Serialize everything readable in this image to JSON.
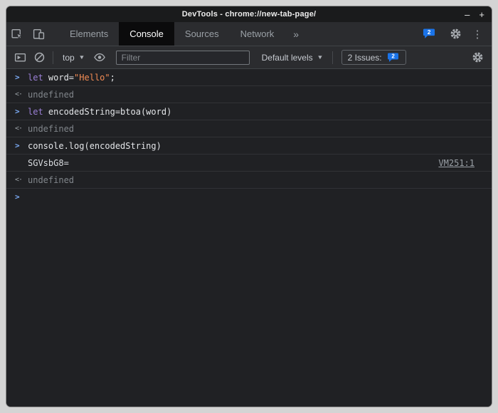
{
  "window": {
    "title": "DevTools - chrome://new-tab-page/"
  },
  "icons": {
    "minimize": "–",
    "close": "+",
    "overflow_chevrons": "»",
    "menu_kebab": "⋮",
    "dropdown_caret": "▼",
    "prompt_chevron": ">",
    "result_arrow": "<·"
  },
  "tabbar": {
    "tabs": [
      "Elements",
      "Console",
      "Sources",
      "Network"
    ],
    "active_tab": "Console",
    "issues_count": "2"
  },
  "toolbar": {
    "context_selector": "top",
    "filter_placeholder": "Filter",
    "levels_selector": "Default levels",
    "issues_label": "2 Issues:",
    "issues_count": "2"
  },
  "console": {
    "rows": [
      {
        "kind": "input",
        "tokens": [
          {
            "c": "kw",
            "t": "let"
          },
          {
            "c": "pl",
            "t": " word="
          },
          {
            "c": "str",
            "t": "\"Hello\""
          },
          {
            "c": "pl",
            "t": ";"
          }
        ]
      },
      {
        "kind": "result",
        "value": "undefined"
      },
      {
        "kind": "input",
        "tokens": [
          {
            "c": "kw",
            "t": "let"
          },
          {
            "c": "pl",
            "t": " encodedString=btoa(word)"
          }
        ]
      },
      {
        "kind": "result",
        "value": "undefined"
      },
      {
        "kind": "input",
        "tokens": [
          {
            "c": "pl",
            "t": "console.log(encodedString)"
          }
        ]
      },
      {
        "kind": "log",
        "text": "SGVsbG8=",
        "link": "VM251:1"
      },
      {
        "kind": "result",
        "value": "undefined"
      },
      {
        "kind": "prompt"
      }
    ]
  },
  "colors": {
    "issues_blue": "#1a73e8",
    "prompt_blue": "#7cacf8",
    "keyword_purple": "#9a7fd5",
    "string_orange": "#f28b54",
    "background": "#202124",
    "toolbar_bg": "#2b2c2f"
  }
}
